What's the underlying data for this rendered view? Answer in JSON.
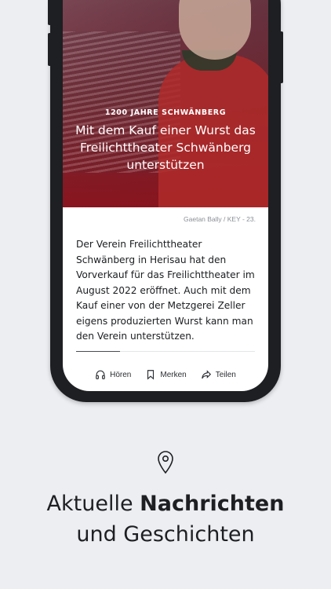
{
  "article": {
    "kicker": "1200 JAHRE SCHWÄNBERG",
    "headline": "Mit dem Kauf einer Wurst das Freilichttheater Schwänberg unterstützen",
    "photo_caption": "Gaetan Bally / KEY - 23.",
    "lead": "Der Verein Freilichttheater Schwänberg in Herisau hat den Vorverkauf für das Freilichttheater im August 2022 eröffnet. Auch mit dem Kauf einer von der Metzgerei Zeller eigens produzierten Wurst kann man den Verein unterstützen."
  },
  "actions": [
    {
      "label": "Hören",
      "icon": "headphones-icon"
    },
    {
      "label": "Merken",
      "icon": "bookmark-icon"
    },
    {
      "label": "Teilen",
      "icon": "share-icon"
    }
  ],
  "promo": {
    "icon": "location-pin-icon",
    "line1_normal": "Aktuelle ",
    "line1_bold": "Nachrichten",
    "line2": "und Geschichten"
  },
  "colors": {
    "background": "#eceef2",
    "phone_frame": "#1d1f22",
    "hero_red": "#8c121c"
  }
}
